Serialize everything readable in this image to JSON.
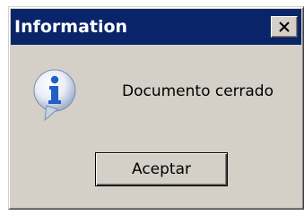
{
  "dialog": {
    "title": "Information",
    "close_icon": "close-icon",
    "icon": "information-icon",
    "message": "Documento cerrado",
    "ok_label": "Aceptar"
  },
  "colors": {
    "titlebar": "#0a246a",
    "title_text": "#ffffff",
    "window_face": "#d4d0c8",
    "icon_blue": "#1f5fc7"
  }
}
